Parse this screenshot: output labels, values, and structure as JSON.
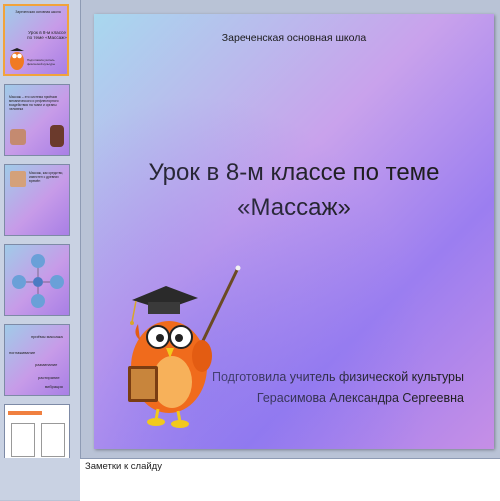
{
  "slide": {
    "school": "Зареченская основная школа",
    "title_line1": "Урок в 8-м классе по теме",
    "title_line2": "«Массаж»",
    "author_line1": "Подготовила учитель физической культуры",
    "author_line2": "Герасимова Александра Сергеевна"
  },
  "notes": {
    "label": "Заметки к слайду"
  },
  "thumbnails": {
    "t1": {
      "title": "Урок в 8-м классе по теме «Массаж»"
    },
    "t5": {
      "label1": "приёмы массажа",
      "label2": "поглаживание",
      "label3": "разминание",
      "label4": "растирание",
      "label5": "вибрация"
    }
  },
  "colors": {
    "active_thumb_border": "#f1a33b",
    "slide_gradient_start": "#a8d8ee",
    "slide_gradient_end": "#9b7ef0"
  }
}
